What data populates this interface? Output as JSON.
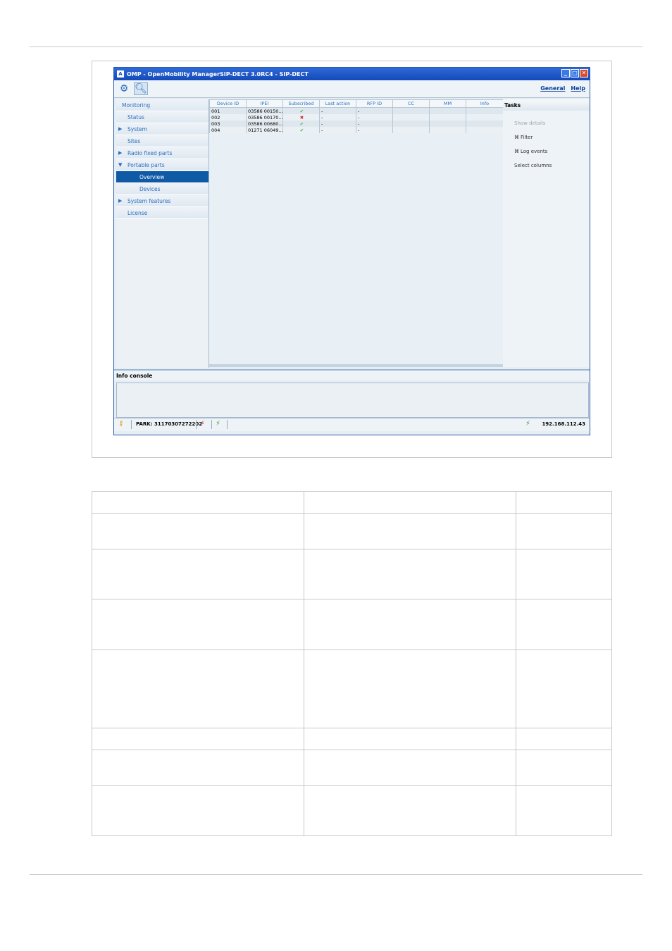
{
  "window": {
    "title": "OMP - OpenMobility ManagerSIP-DECT 3.0RC4 - SIP-DECT",
    "app_icon": "A",
    "controls": {
      "minimize": "_",
      "maximize": "□",
      "close": "✕"
    }
  },
  "toolbar": {
    "links": [
      "General",
      "Help"
    ]
  },
  "nav": {
    "items": [
      {
        "label": "Monitoring",
        "indent": 0,
        "arrow": ""
      },
      {
        "label": "Status",
        "indent": 1,
        "arrow": ""
      },
      {
        "label": "System",
        "indent": 1,
        "arrow": "▶"
      },
      {
        "label": "Sites",
        "indent": 1,
        "arrow": ""
      },
      {
        "label": "Radio fixed parts",
        "indent": 1,
        "arrow": "▶"
      },
      {
        "label": "Portable parts",
        "indent": 1,
        "arrow": "▼"
      },
      {
        "label": "Overview",
        "indent": 2,
        "arrow": "",
        "selected": true
      },
      {
        "label": "Devices",
        "indent": 2,
        "arrow": ""
      },
      {
        "label": "System features",
        "indent": 1,
        "arrow": "▶"
      },
      {
        "label": "License",
        "indent": 1,
        "arrow": ""
      }
    ]
  },
  "grid": {
    "columns": [
      "Device ID",
      "IPEI",
      "Subscribed",
      "Last action",
      "RFP ID",
      "CC",
      "MM",
      "Info"
    ],
    "rows": [
      {
        "device_id": "001",
        "ipei": "03586 00150...",
        "subscribed": "✔",
        "state": "ok",
        "last_action": "-",
        "rfp_id": "-"
      },
      {
        "device_id": "002",
        "ipei": "03586 00170...",
        "subscribed": "✖",
        "state": "bad",
        "last_action": "-",
        "rfp_id": "-"
      },
      {
        "device_id": "003",
        "ipei": "03586 00680...",
        "subscribed": "✔",
        "state": "ok",
        "last_action": "-",
        "rfp_id": "-"
      },
      {
        "device_id": "004",
        "ipei": "01271 06049...",
        "subscribed": "✔",
        "state": "ok",
        "last_action": "-",
        "rfp_id": "-"
      }
    ]
  },
  "tasks": {
    "title": "Tasks",
    "items": [
      {
        "label": "Show details",
        "icon": ""
      },
      {
        "label": "Filter",
        "icon": "⌘"
      },
      {
        "label": "Log events",
        "icon": "⌘"
      },
      {
        "label": "Select columns",
        "icon": ""
      }
    ]
  },
  "console": {
    "title": "Info console"
  },
  "statusbar": {
    "park": "PARK: 31170307272202",
    "ip": "192.168.112.43"
  }
}
